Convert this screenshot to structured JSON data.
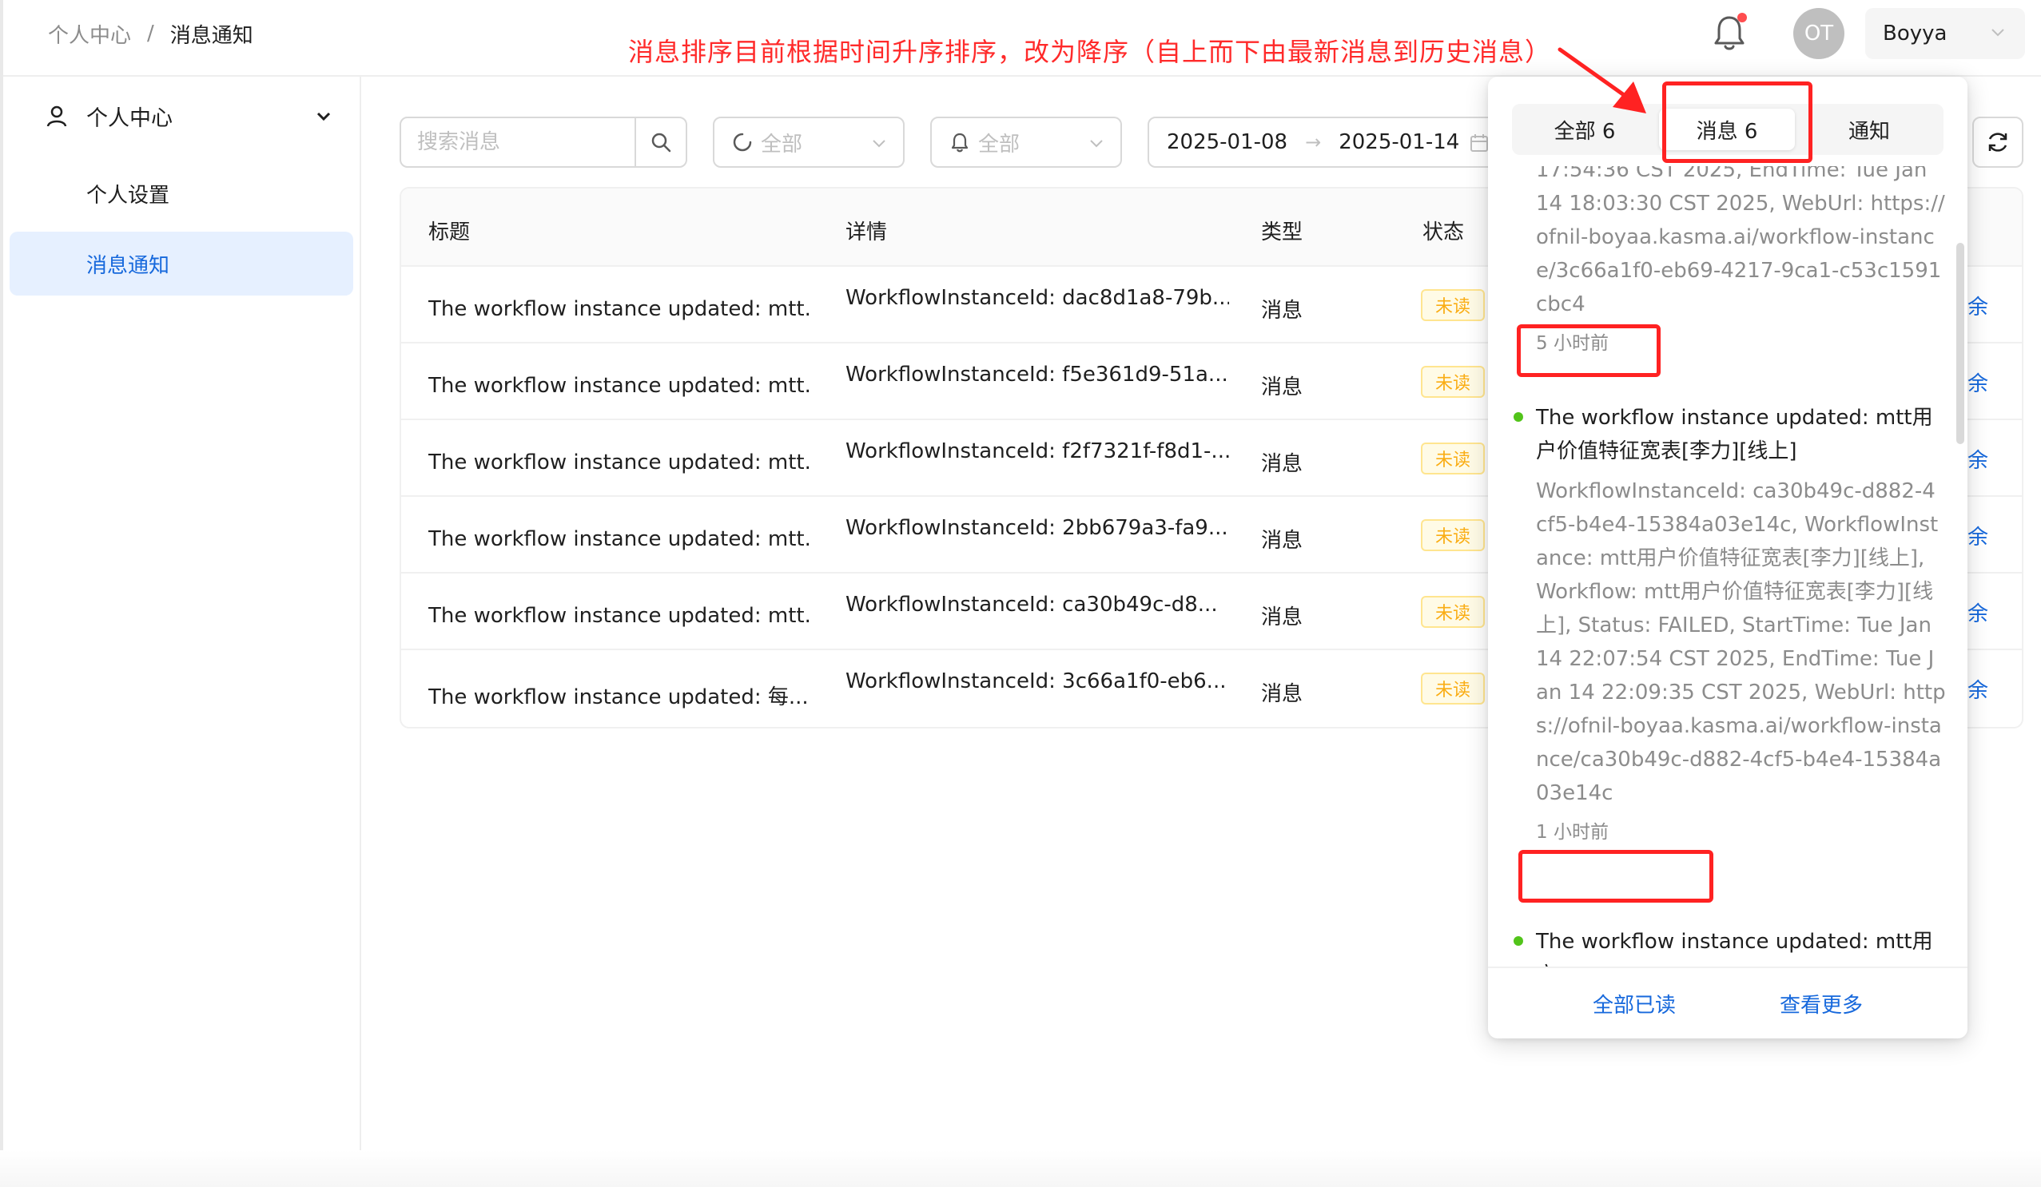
{
  "header": {
    "breadcrumb": [
      "个人中心",
      "消息通知"
    ],
    "breadcrumb_sep": "/",
    "annotation_text": "消息排序目前根据时间升序排序，改为降序（自上而下由最新消息到历史消息）",
    "avatar_initials": "OT",
    "user_name": "Boyya"
  },
  "sidebar": {
    "group_label": "个人中心",
    "items": [
      {
        "label": "个人设置",
        "active": false
      },
      {
        "label": "消息通知",
        "active": true
      }
    ]
  },
  "filters": {
    "search_placeholder": "搜索消息",
    "status_select": "全部",
    "type_select": "全部",
    "date_start": "2025-01-08",
    "date_end": "2025-01-14"
  },
  "table": {
    "columns": [
      "标题",
      "详情",
      "类型",
      "状态"
    ],
    "rows": [
      {
        "title": "The workflow instance updated: mtt...",
        "detail": "WorkflowInstanceId: dac8d1a8-79b...",
        "type": "消息",
        "status": "未读",
        "action": "余"
      },
      {
        "title": "The workflow instance updated: mtt...",
        "detail": "WorkflowInstanceId: f5e361d9-51a...",
        "type": "消息",
        "status": "未读",
        "action": "余"
      },
      {
        "title": "The workflow instance updated: mtt...",
        "detail": "WorkflowInstanceId: f2f7321f-f8d1-...",
        "type": "消息",
        "status": "未读",
        "action": "余"
      },
      {
        "title": "The workflow instance updated: mtt...",
        "detail": "WorkflowInstanceId: 2bb679a3-fa9...",
        "type": "消息",
        "status": "未读",
        "action": "余"
      },
      {
        "title": "The workflow instance updated: mtt...",
        "detail": "WorkflowInstanceId: ca30b49c-d8...",
        "type": "消息",
        "status": "未读",
        "action": "余"
      },
      {
        "title": "The workflow instance updated: 每...",
        "detail": "WorkflowInstanceId: 3c66a1f0-eb6...",
        "type": "消息",
        "status": "未读",
        "action": "余"
      }
    ]
  },
  "popover": {
    "tabs": [
      {
        "label": "全部 6",
        "active": false
      },
      {
        "label": "消息 6",
        "active": true
      },
      {
        "label": "通知",
        "active": false
      }
    ],
    "messages": [
      {
        "title": "",
        "detail": "17:54:36 CST 2025, EndTime: Tue Jan 14 18:03:30 CST 2025, WebUrl: https://ofnil-boyaa.kasma.ai/workflow-instance/3c66a1f0-eb69-4217-9ca1-c53c1591cbc4",
        "time": "5 小时前"
      },
      {
        "title": "The workflow instance updated: mtt用户价值特征宽表[李力][线上]",
        "detail": "WorkflowInstanceId: ca30b49c-d882-4cf5-b4e4-15384a03e14c, WorkflowInstance: mtt用户价值特征宽表[李力][线上], Workflow: mtt用户价值特征宽表[李力][线上], Status: FAILED, StartTime: Tue Jan 14 22:07:54 CST 2025, EndTime: Tue Jan 14 22:09:35 CST 2025, WebUrl: https://ofnil-boyaa.kasma.ai/workflow-instance/ca30b49c-d882-4cf5-b4e4-15384a03e14c",
        "time": "1 小时前"
      },
      {
        "title": "The workflow instance updated: mtt用户",
        "detail": "",
        "time": ""
      }
    ],
    "footer": {
      "mark_all_read": "全部已读",
      "view_more": "查看更多"
    }
  },
  "colors": {
    "primary": "#1668dc",
    "annotation_red": "#ff2222",
    "unread_badge": "#faad14",
    "online_dot": "#52c41a",
    "bell_dot": "#ff4d4f"
  }
}
